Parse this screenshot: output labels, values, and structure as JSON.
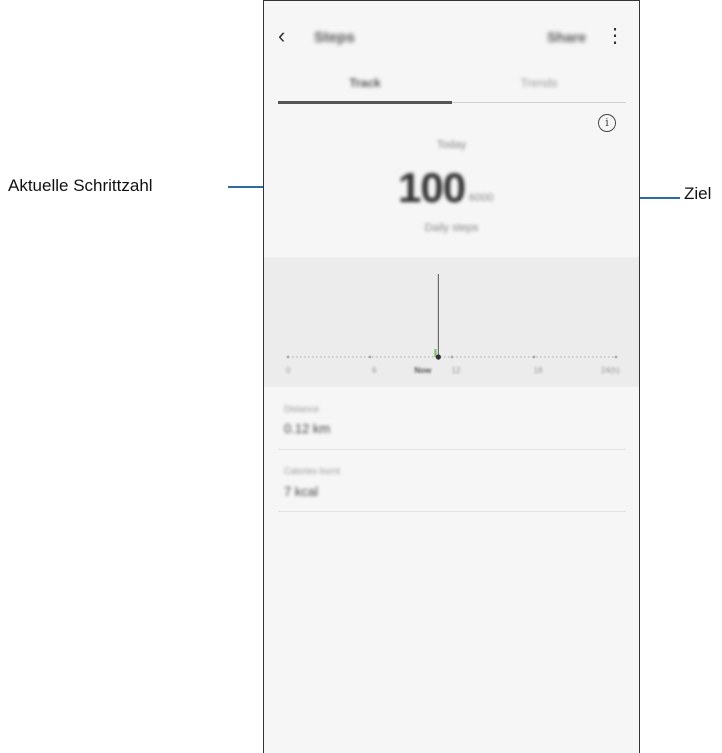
{
  "callouts": {
    "current_steps": "Aktuelle Schrittzahl",
    "goal": "Ziel"
  },
  "appbar": {
    "back_icon": "chevron-left-icon",
    "back_glyph": "‹",
    "title": "Steps",
    "share_label": "Share",
    "more_icon": "more-vertical-icon",
    "more_glyph": "⋮"
  },
  "tabs": [
    {
      "label": "Track",
      "selected": true
    },
    {
      "label": "Trends",
      "selected": false
    }
  ],
  "info_icon": "info-icon",
  "info_glyph": "i",
  "summary": {
    "today_label": "Today",
    "steps": "100",
    "slash": "/",
    "goal": "6000",
    "daily_steps_label": "Daily steps"
  },
  "chart_data": {
    "type": "bar",
    "x_ticks": [
      "0",
      "6",
      "Now",
      "12",
      "18",
      "24(h)"
    ],
    "current_hour": 11,
    "values": [
      {
        "hour": 11,
        "steps": 100
      }
    ]
  },
  "metrics": [
    {
      "label": "Distance",
      "value": "0.12 km"
    },
    {
      "label": "Calories burnt",
      "value": "7 kcal"
    }
  ],
  "colors": {
    "leader_line": "#2b6c9b",
    "bar": "#7dc36b",
    "chart_bg": "#ececec"
  }
}
